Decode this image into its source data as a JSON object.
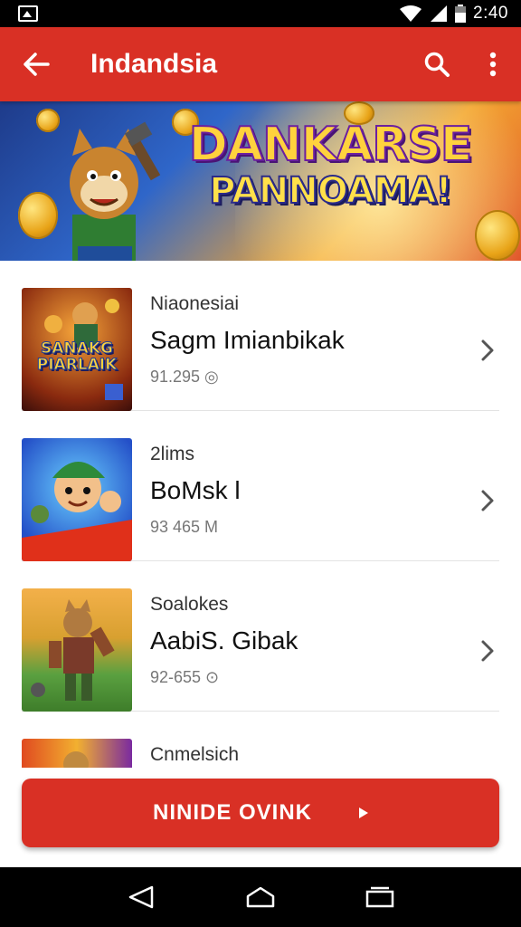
{
  "status_bar": {
    "time": "2:40"
  },
  "app_bar": {
    "title": "Indandsia"
  },
  "banner": {
    "line1": "DANKARSE",
    "line2": "PANNOAMA!"
  },
  "list": {
    "items": [
      {
        "category": "Niaonesiai",
        "name": "Sagm Imianbikak",
        "sub": "91.295 ◎",
        "thumb_text": "SANAKG PIARLAIK"
      },
      {
        "category": "2lims",
        "name": "BoMsk l",
        "sub": "93 465  M"
      },
      {
        "category": "Soalokes",
        "name": "AabiS. Gibak",
        "sub": "92-655 ⊙"
      },
      {
        "category": "Cnmelsich"
      }
    ]
  },
  "cta": {
    "label": "NINIDE OVINK"
  },
  "colors": {
    "primary": "#d93025",
    "status_bar": "#000000"
  },
  "icons": [
    "gallery-icon",
    "wifi-icon",
    "signal-icon",
    "battery-icon",
    "back-arrow-icon",
    "search-icon",
    "more-vert-icon",
    "chevron-right-icon",
    "play-icon",
    "nav-back-icon",
    "nav-home-icon",
    "nav-recents-icon"
  ]
}
